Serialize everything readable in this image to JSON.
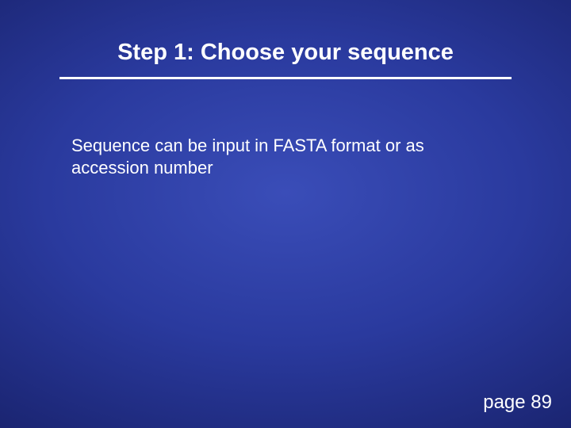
{
  "slide": {
    "title": "Step 1: Choose your sequence",
    "body": "Sequence can be input in FASTA format or as accession number",
    "page_label": "page 89"
  }
}
